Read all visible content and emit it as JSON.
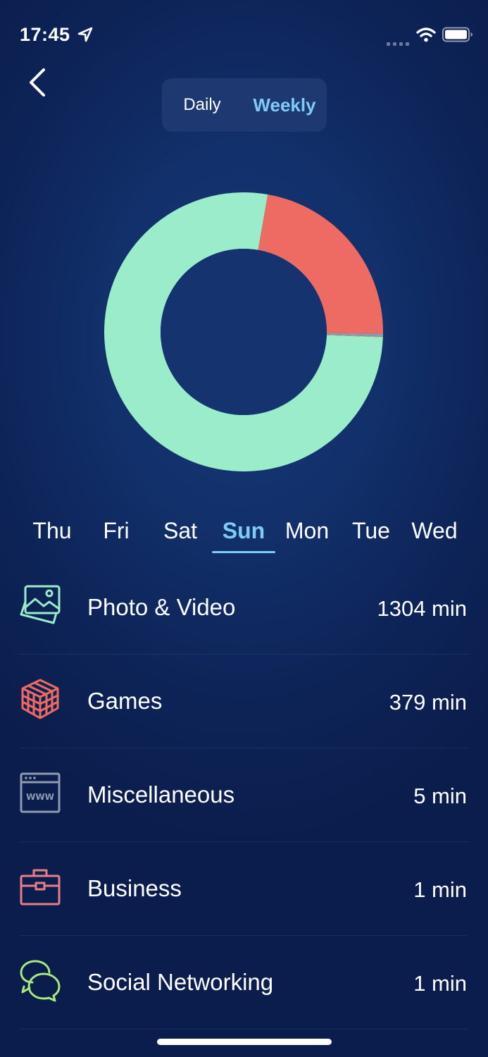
{
  "status_bar": {
    "time": "17:45",
    "location_icon": "location-arrow-icon",
    "signal_icon": "cellular-signal-icon",
    "wifi_icon": "wifi-icon",
    "battery_icon": "battery-icon"
  },
  "nav": {
    "back_icon": "chevron-left-icon"
  },
  "period_toggle": {
    "options": [
      "Daily",
      "Weekly"
    ],
    "selected": "Weekly"
  },
  "days": {
    "items": [
      "Thu",
      "Fri",
      "Sat",
      "Sun",
      "Mon",
      "Tue",
      "Wed"
    ],
    "selected": "Sun"
  },
  "categories": [
    {
      "label": "Photo & Video",
      "value": "1304 min",
      "minutes": 1304,
      "icon": "photo-video-icon",
      "color": "#9aecca"
    },
    {
      "label": "Games",
      "value": "379 min",
      "minutes": 379,
      "icon": "games-cube-icon",
      "color": "#ee6b63"
    },
    {
      "label": "Miscellaneous",
      "value": "5 min",
      "minutes": 5,
      "icon": "browser-window-icon",
      "color": "#8e9bb0"
    },
    {
      "label": "Business",
      "value": "1 min",
      "minutes": 1,
      "icon": "briefcase-icon",
      "color": "#e57e88"
    },
    {
      "label": "Social Networking",
      "value": "1 min",
      "minutes": 1,
      "icon": "chat-bubbles-icon",
      "color": "#a8ea7c"
    }
  ],
  "colors": {
    "accent": "#7ecbf6",
    "background": "#0d2357",
    "donut_hole": "#14336f"
  },
  "chart_data": {
    "type": "pie",
    "variant": "donut",
    "categories": [
      "Photo & Video",
      "Games",
      "Miscellaneous",
      "Business",
      "Social Networking"
    ],
    "values": [
      1304,
      379,
      5,
      1,
      1
    ],
    "colors": [
      "#9aecca",
      "#ee6b63",
      "#8e9bb0",
      "#e57e88",
      "#a8ea7c"
    ]
  }
}
